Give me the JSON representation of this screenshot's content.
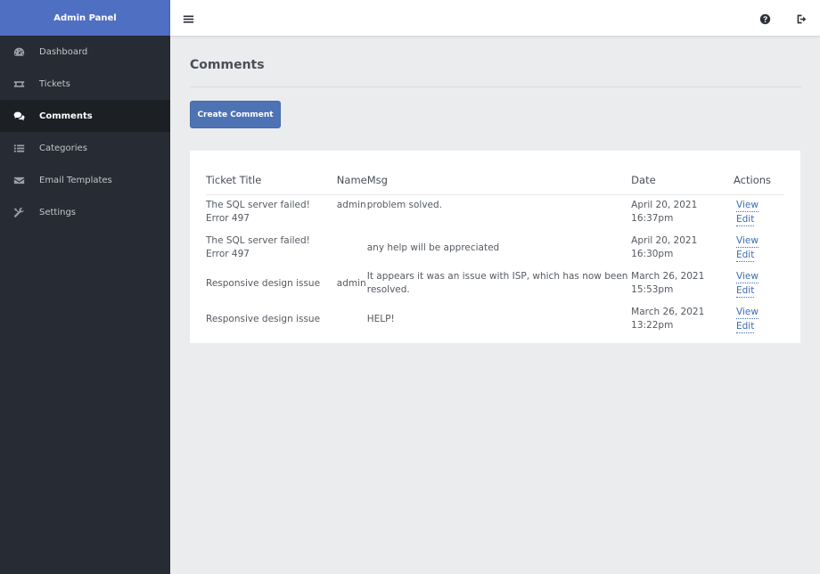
{
  "sidebar": {
    "brand": "Admin Panel",
    "items": [
      {
        "label": "Dashboard",
        "icon": "dashboard-icon"
      },
      {
        "label": "Tickets",
        "icon": "ticket-icon"
      },
      {
        "label": "Comments",
        "icon": "comments-icon",
        "active": true
      },
      {
        "label": "Categories",
        "icon": "list-icon"
      },
      {
        "label": "Email Templates",
        "icon": "envelope-icon"
      },
      {
        "label": "Settings",
        "icon": "wrench-icon"
      }
    ]
  },
  "topbar": {
    "menu_icon": "hamburger-icon",
    "help_icon": "question-circle-icon",
    "logout_icon": "sign-out-icon"
  },
  "main": {
    "title": "Comments",
    "create_button": "Create Comment",
    "table": {
      "headers": [
        "Ticket Title",
        "Name",
        "Msg",
        "Date",
        "Actions"
      ],
      "rows": [
        {
          "title": "The SQL server failed! Error 497",
          "name": "admin",
          "msg": "problem solved.",
          "date": "April 20, 2021 16:37pm",
          "view": "View",
          "edit": "Edit"
        },
        {
          "title": "The SQL server failed! Error 497",
          "name": "",
          "msg": "any help will be appreciated",
          "date": "April 20, 2021 16:30pm",
          "view": "View",
          "edit": "Edit"
        },
        {
          "title": "Responsive design issue",
          "name": "admin",
          "msg": "It appears it was an issue with ISP, which has now been resolved.",
          "date": "March 26, 2021 15:53pm",
          "view": "View",
          "edit": "Edit"
        },
        {
          "title": "Responsive design issue",
          "name": "",
          "msg": "HELP!",
          "date": "March 26, 2021 13:22pm",
          "view": "View",
          "edit": "Edit"
        }
      ]
    }
  },
  "colors": {
    "sidebar_bg": "#272b33",
    "brand_bg": "#4f6fc2",
    "active_item_bg": "#1c1f24",
    "accent_button": "#4e73b5",
    "link": "#3b6db5",
    "page_bg": "#ebecee"
  }
}
